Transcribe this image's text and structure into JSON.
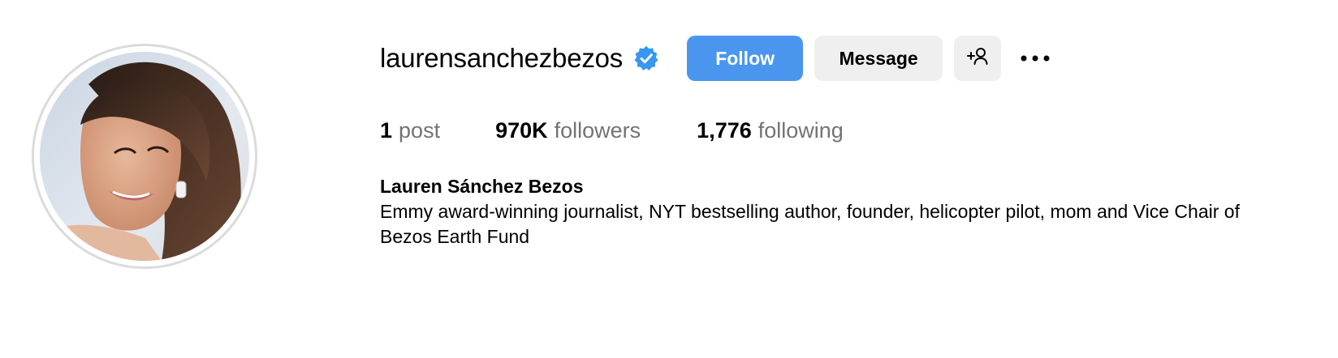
{
  "profile": {
    "username": "laurensanchezbezos",
    "verified": true,
    "full_name": "Lauren Sánchez Bezos",
    "bio": "Emmy award-winning journalist, NYT bestselling author, founder, helicopter pilot, mom and Vice Chair of Bezos Earth Fund"
  },
  "actions": {
    "follow_label": "Follow",
    "message_label": "Message",
    "suggest_icon": "add-person-icon",
    "more_icon": "more-options-icon"
  },
  "stats": {
    "posts": {
      "count": "1",
      "label": "post"
    },
    "followers": {
      "count": "970K",
      "label": "followers"
    },
    "following": {
      "count": "1,776",
      "label": "following"
    }
  },
  "colors": {
    "follow_button": "#4a96ef",
    "secondary_button": "#efefef",
    "verified_badge": "#3897f0",
    "muted_text": "#737373"
  }
}
